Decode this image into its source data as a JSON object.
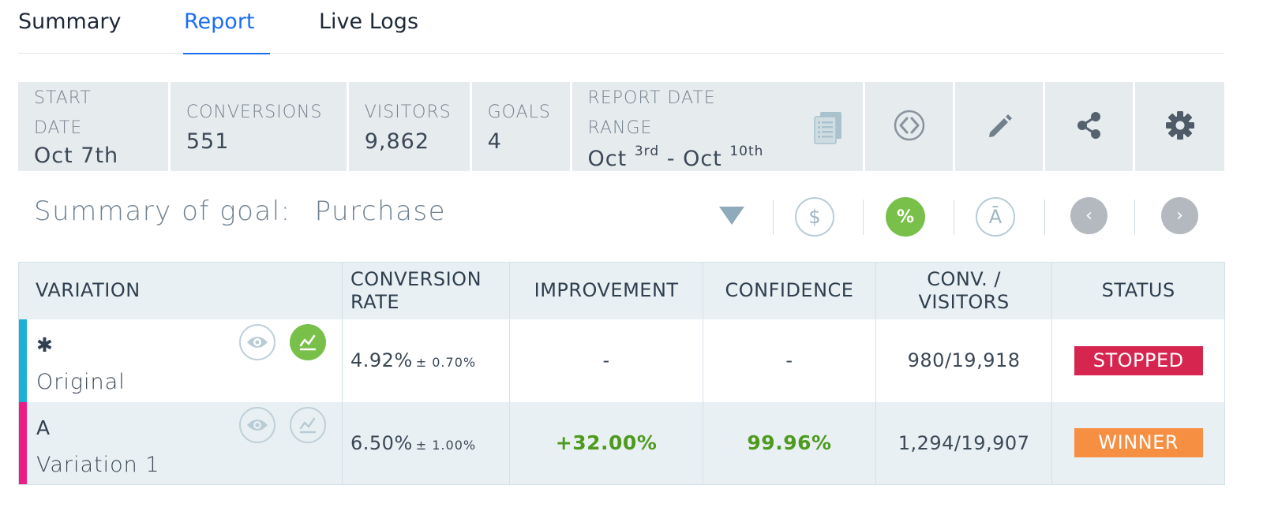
{
  "tabs": [
    {
      "label": "Summary",
      "active": false
    },
    {
      "label": "Report",
      "active": true
    },
    {
      "label": "Live Logs",
      "active": false
    }
  ],
  "stats": {
    "start_date": {
      "label_line1": "START",
      "label_line2": "DATE",
      "value": "Oct 7th"
    },
    "conversions": {
      "label": "CONVERSIONS",
      "value": "551"
    },
    "visitors": {
      "label": "VISITORS",
      "value": "9,862"
    },
    "goals": {
      "label": "GOALS",
      "value": "4"
    },
    "report_range": {
      "label_line1": "REPORT DATE",
      "label_line2": "RANGE",
      "from_month": "Oct",
      "from_day": "3rd",
      "separator": "-",
      "to_month": "Oct",
      "to_day": "10th",
      "icon": "report-document-icon"
    },
    "actions": [
      {
        "name": "code-icon",
        "label": "Code"
      },
      {
        "name": "pencil-icon",
        "label": "Edit"
      },
      {
        "name": "share-icon",
        "label": "Share"
      },
      {
        "name": "gear-icon",
        "label": "Settings"
      }
    ]
  },
  "goal": {
    "prefix": "Summary of goal:",
    "name": "Purchase",
    "dropdown_icon": "caret-down-icon",
    "tools": {
      "revenue": "$",
      "percent": "%",
      "average": "Ā",
      "prev": "‹",
      "next": "›"
    }
  },
  "table": {
    "headers": {
      "variation": "VARIATION",
      "rate_line1": "CONVERSION",
      "rate_line2": "RATE",
      "improvement": "IMPROVEMENT",
      "confidence": "CONFIDENCE",
      "conv_line1": "CONV. /",
      "conv_line2": "VISITORS",
      "status": "STATUS"
    },
    "rows": [
      {
        "key": "✱",
        "name": "Original",
        "color": "#1cb0d6",
        "rate": "4.92%",
        "rate_pm": "± 0.70%",
        "improvement": "-",
        "confidence": "-",
        "conv_visitors": "980/19,918",
        "status": "STOPPED",
        "status_color": "#d6264f",
        "chart_active": true
      },
      {
        "key": "A",
        "name": "Variation 1",
        "color": "#ee1b84",
        "rate": "6.50%",
        "rate_pm": "± 1.00%",
        "improvement": "+32.00%",
        "confidence": "99.96%",
        "conv_visitors": "1,294/19,907",
        "status": "WINNER",
        "status_color": "#f78f43",
        "chart_active": false
      }
    ]
  }
}
